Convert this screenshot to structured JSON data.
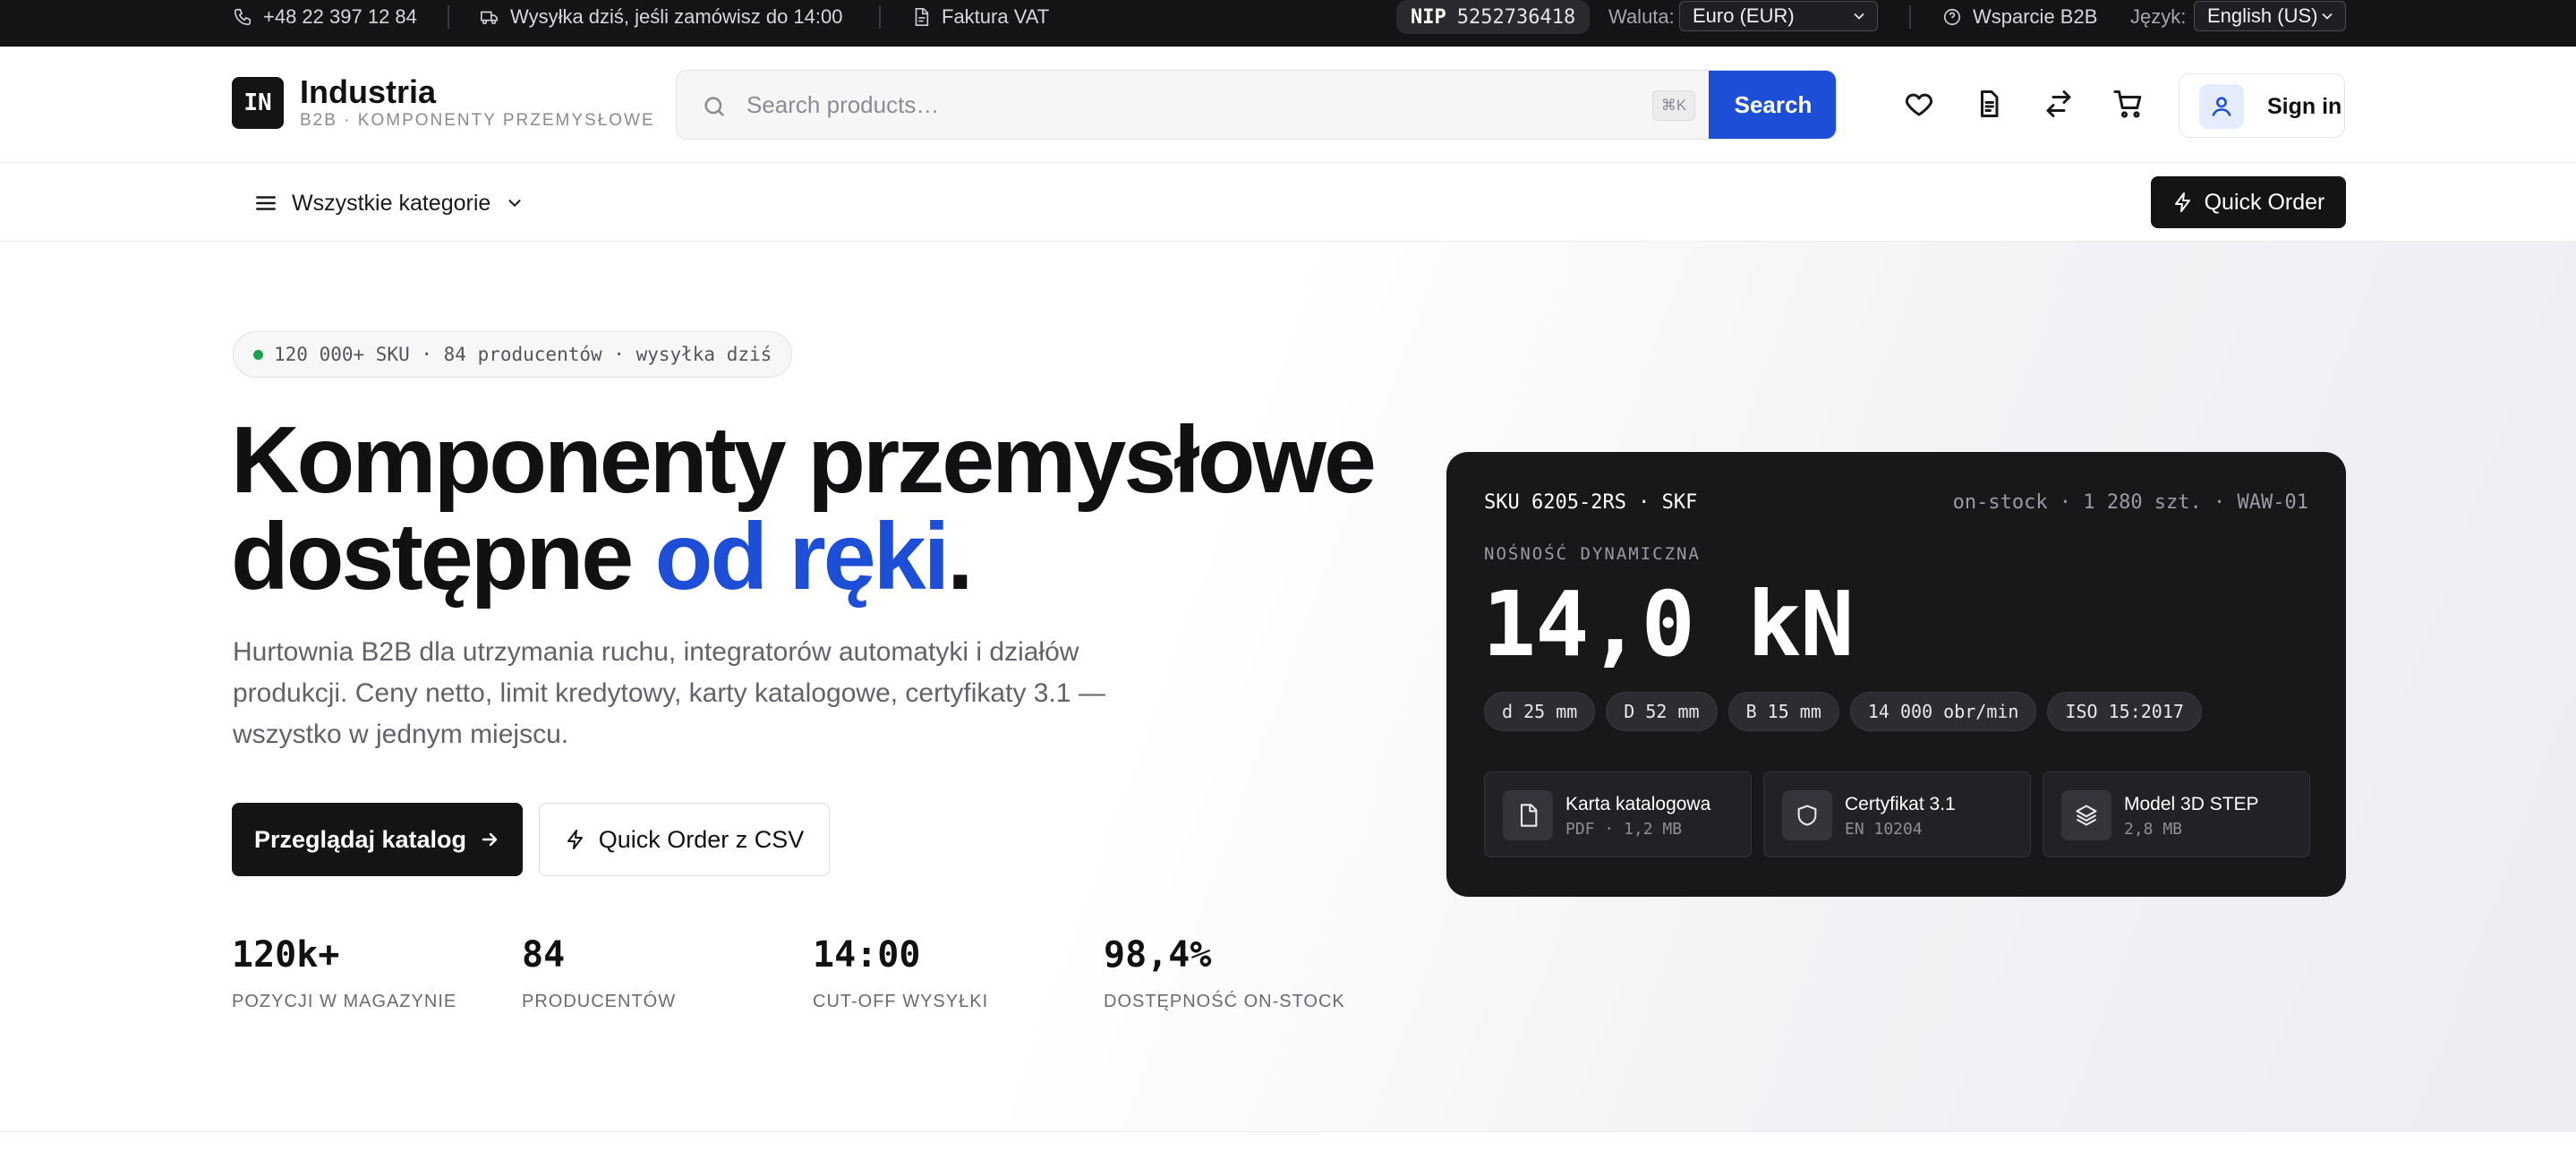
{
  "topbar": {
    "phone": "+48 22 397 12 84",
    "shipping": "Wysyłka dziś, jeśli zamówisz do 14:00",
    "invoice": "Faktura VAT",
    "nip_label": "NIP",
    "nip_value": "5252736418",
    "currency_label": "Waluta:",
    "currency_value": "Euro (EUR)",
    "support": "Wsparcie B2B",
    "language_label": "Język:",
    "language_value": "English (US)"
  },
  "header": {
    "logo_mark": "IN",
    "brand_name": "Industria",
    "brand_sub": "B2B · KOMPONENTY PRZEMYSŁOWE",
    "search_placeholder": "Search products…",
    "search_shortcut": "⌘K",
    "search_button": "Search",
    "icons": [
      "heart-icon",
      "document-icon",
      "compare-icon",
      "cart-icon"
    ],
    "signin_label": "Sign in"
  },
  "nav": {
    "categories_label": "Wszystkie kategorie",
    "quick_order_label": "Quick Order"
  },
  "hero": {
    "pill_text": "120 000+ SKU · 84 producentów · wysyłka dziś",
    "title_line1": "Komponenty przemysłowe",
    "title_line2_plain": "dostępne ",
    "title_line2_accent": "od ręki",
    "title_line2_end": ".",
    "lead": "Hurtownia B2B dla utrzymania ruchu, integratorów automatyki i działów produkcji. Ceny netto, limit kredytowy, karty katalogowe, certyfikaty 3.1 — wszystko w jednym miejscu.",
    "primary_button": "Przeglądaj katalog",
    "secondary_button": "Quick Order z CSV",
    "stats": [
      {
        "value": "120k+",
        "label": "POZYCJI W MAGAZYNIE"
      },
      {
        "value": "84",
        "label": "PRODUCENTÓW"
      },
      {
        "value": "14:00",
        "label": "CUT-OFF WYSYŁKI"
      },
      {
        "value": "98,4%",
        "label": "DOSTĘPNOŚĆ ON-STOCK"
      }
    ]
  },
  "product_card": {
    "sku": "SKU 6205-2RS · SKF",
    "stock": "on-stock · 1 280 szt. · WAW-01",
    "caption": "NOŚNOŚĆ DYNAMICZNA",
    "value": "14,0 kN",
    "chips": [
      "d 25 mm",
      "D 52 mm",
      "B 15 mm",
      "14 000 obr/min",
      "ISO 15:2017"
    ],
    "documents": [
      {
        "title": "Karta katalogowa",
        "meta": "PDF · 1,2 MB",
        "icon": "file-icon"
      },
      {
        "title": "Certyfikat 3.1",
        "meta": "EN 10204",
        "icon": "shield-icon"
      },
      {
        "title": "Model 3D STEP",
        "meta": "2,8 MB",
        "icon": "layers-icon"
      }
    ]
  },
  "colors": {
    "accent": "#1d4ed8",
    "dark": "#141416",
    "card": "#18181b",
    "status_green": "#16a34a"
  }
}
